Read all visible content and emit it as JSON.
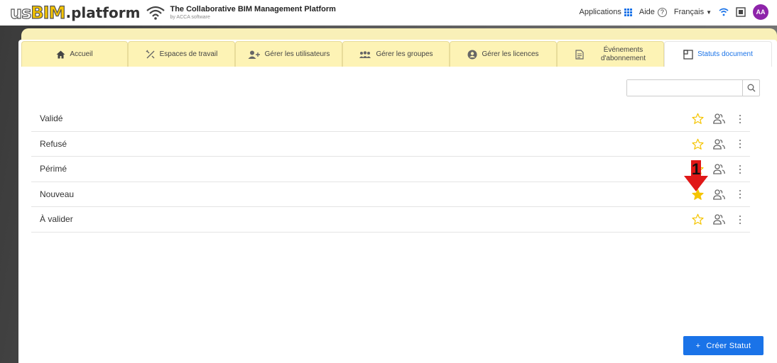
{
  "header": {
    "logo_us": "us",
    "logo_bim": "BIM",
    "logo_platform": ".platform",
    "tagline": "The Collaborative BIM Management Platform",
    "tagline_sub": "by ACCA software",
    "applications_label": "Applications",
    "help_label": "Aide",
    "help_icon": "?",
    "language": "Français",
    "avatar_initials": "AA"
  },
  "tabs": [
    {
      "label": "Accueil",
      "icon": "home-icon"
    },
    {
      "label": "Espaces de travail",
      "icon": "tools-icon"
    },
    {
      "label": "Gérer les utilisateurs",
      "icon": "add-user-icon"
    },
    {
      "label": "Gérer les groupes",
      "icon": "groups-icon"
    },
    {
      "label": "Gérer les licences",
      "icon": "account-circle-icon"
    },
    {
      "label_line1": "Événements",
      "label_line2": "d'abonnement",
      "icon": "document-icon"
    },
    {
      "label": "Statuts document",
      "icon": "status-icon",
      "active": true
    }
  ],
  "search": {
    "value": "",
    "placeholder": ""
  },
  "statuses": [
    {
      "label": "Validé",
      "favorite": false
    },
    {
      "label": "Refusé",
      "favorite": false
    },
    {
      "label": "Périmé",
      "favorite": false
    },
    {
      "label": "Nouveau",
      "favorite": true
    },
    {
      "label": "À valider",
      "favorite": false
    }
  ],
  "marker": {
    "number": "1"
  },
  "create_button": {
    "icon": "+",
    "label": "Créer Statut"
  },
  "colors": {
    "accent": "#1a73e8",
    "star": "#f5c400",
    "tab_bg": "#fdf3b5",
    "avatar": "#8e24aa",
    "marker": "#e01818"
  }
}
